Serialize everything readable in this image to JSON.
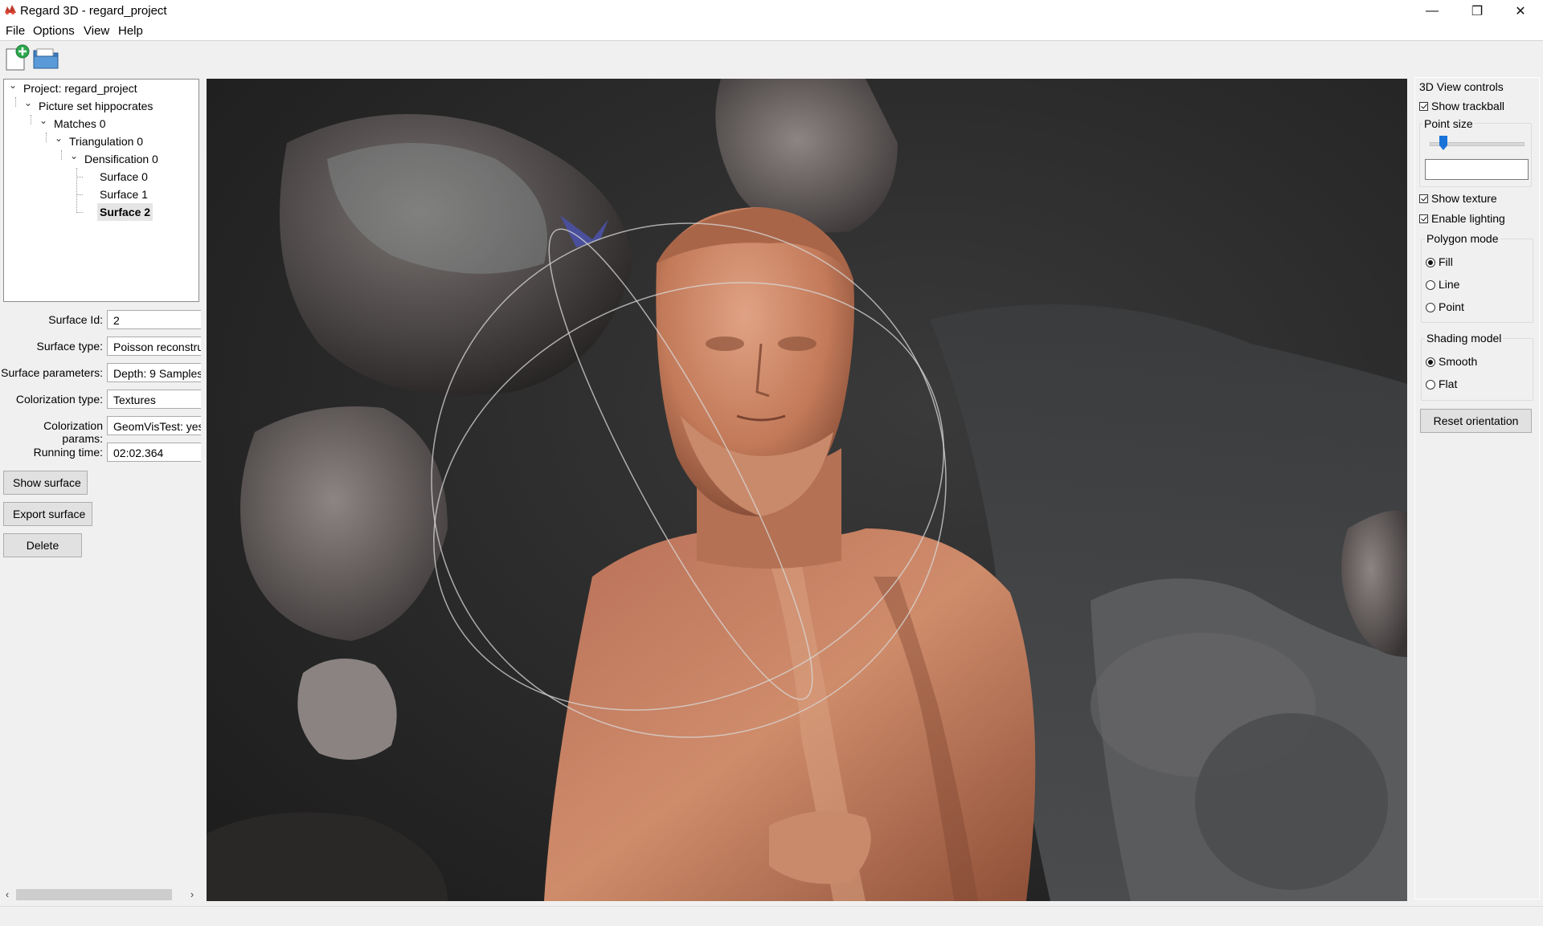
{
  "window": {
    "title": "Regard 3D - regard_project",
    "minimize_icon": "—",
    "restore_icon": "❐",
    "close_icon": "✕"
  },
  "menu": [
    "File",
    "Options",
    "View",
    "Help"
  ],
  "tree": {
    "items": [
      {
        "label": "Project: regard_project",
        "level": 0,
        "expanded": true
      },
      {
        "label": "Picture set hippocrates",
        "level": 1,
        "expanded": true
      },
      {
        "label": "Matches 0",
        "level": 2,
        "expanded": true
      },
      {
        "label": "Triangulation 0",
        "level": 3,
        "expanded": true
      },
      {
        "label": "Densification 0",
        "level": 4,
        "expanded": true
      },
      {
        "label": "Surface 0",
        "level": 5
      },
      {
        "label": "Surface 1",
        "level": 5
      },
      {
        "label": "Surface 2",
        "level": 5,
        "selected": true
      }
    ]
  },
  "properties": [
    {
      "label": "Surface Id:",
      "value": "2"
    },
    {
      "label": "Surface type:",
      "value": "Poisson reconstru"
    },
    {
      "label": "Surface parameters:",
      "value": "Depth: 9 Samples"
    },
    {
      "label": "Colorization type:",
      "value": "Textures"
    },
    {
      "label": "Colorization params:",
      "value": "GeomVisTest: yes"
    },
    {
      "label": "Running time:",
      "value": "02:02.364"
    }
  ],
  "buttons": {
    "show_surface": "Show surface",
    "export_surface": "Export surface",
    "delete": "Delete"
  },
  "scroll_arrows": {
    "left": "‹",
    "right": "›"
  },
  "view_controls": {
    "title": "3D View controls",
    "show_trackball": "Show trackball",
    "point_size_label": "Point size",
    "point_size_value": "",
    "show_texture": "Show texture",
    "enable_lighting": "Enable lighting",
    "polygon_mode": {
      "title": "Polygon mode",
      "options": [
        "Fill",
        "Line",
        "Point"
      ],
      "selected": "Fill"
    },
    "shading_model": {
      "title": "Shading model",
      "options": [
        "Smooth",
        "Flat"
      ],
      "selected": "Smooth"
    },
    "reset_orientation": "Reset orientation"
  },
  "icons": {
    "app": "regard3d-logo-icon",
    "new_project": "new-project-icon",
    "open_project": "open-folder-icon"
  },
  "colors": {
    "viewport_bg": "#2b2b2b",
    "statue": "#c97f5e",
    "slider_accent": "#1a73d9"
  }
}
